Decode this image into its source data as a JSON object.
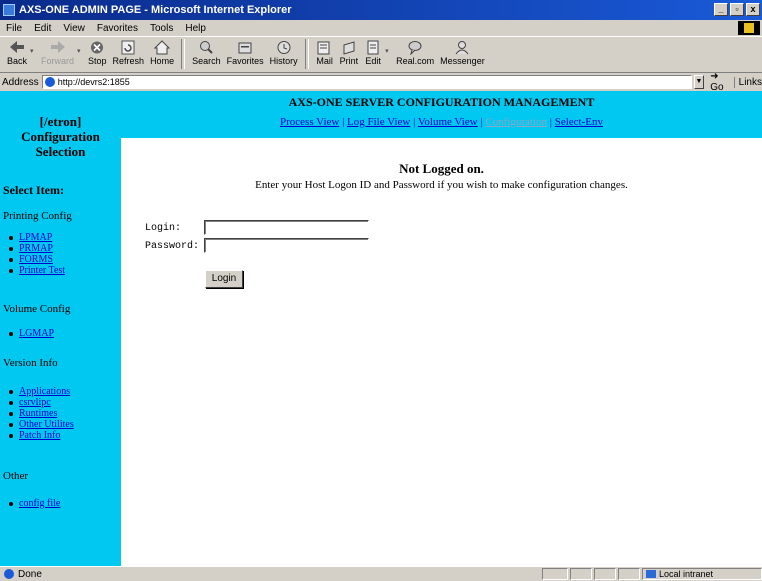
{
  "window": {
    "title": "AXS-ONE ADMIN PAGE - Microsoft Internet Explorer",
    "min": "_",
    "max": "▫",
    "close": "x"
  },
  "menu": [
    "File",
    "Edit",
    "View",
    "Favorites",
    "Tools",
    "Help"
  ],
  "toolbar": [
    {
      "label": "Back",
      "icon": "back-arrow-icon",
      "enabled": true
    },
    {
      "label": "Forward",
      "icon": "forward-arrow-icon",
      "enabled": false
    },
    {
      "label": "Stop",
      "icon": "stop-icon",
      "enabled": true
    },
    {
      "label": "Refresh",
      "icon": "refresh-icon",
      "enabled": true
    },
    {
      "label": "Home",
      "icon": "home-icon",
      "enabled": true
    },
    {
      "label": "Search",
      "icon": "search-icon",
      "enabled": true
    },
    {
      "label": "Favorites",
      "icon": "favorites-icon",
      "enabled": true
    },
    {
      "label": "History",
      "icon": "history-icon",
      "enabled": true
    },
    {
      "label": "Mail",
      "icon": "mail-icon",
      "enabled": true
    },
    {
      "label": "Print",
      "icon": "print-icon",
      "enabled": true
    },
    {
      "label": "Edit",
      "icon": "edit-icon",
      "enabled": true
    },
    {
      "label": "Real.com",
      "icon": "realcom-icon",
      "enabled": true
    },
    {
      "label": "Messenger",
      "icon": "messenger-icon",
      "enabled": true
    }
  ],
  "address": {
    "label": "Address",
    "url": "http://devrs2:1855",
    "go": "Go",
    "links": "Links"
  },
  "sidebar": {
    "header_line1": "[/etron]",
    "header_line2": "Configuration",
    "header_line3": "Selection",
    "select_item": "Select Item:",
    "printing_title": "Printing Config",
    "printing_items": [
      "LPMAP",
      "PRMAP",
      "FORMS",
      "Printer Test"
    ],
    "volume_title": "Volume Config",
    "volume_items": [
      "LGMAP"
    ],
    "version_title": "Version Info",
    "version_items": [
      "Applications",
      "csrvlipc",
      "Runtimes",
      "Other Utilites",
      "Patch Info"
    ],
    "other_title": "Other",
    "other_items": [
      "config file"
    ]
  },
  "top": {
    "title": "AXS-ONE SERVER CONFIGURATION MANAGEMENT",
    "links": [
      {
        "label": "Process View",
        "current": false
      },
      {
        "label": "Log File View",
        "current": false
      },
      {
        "label": "Volume View",
        "current": false
      },
      {
        "label": "Configuration",
        "current": true
      },
      {
        "label": "Select-Env",
        "current": false
      }
    ],
    "separator": "|"
  },
  "main": {
    "heading": "Not Logged on.",
    "message": "Enter your Host Logon ID and Password if you wish to make configuration changes.",
    "login_label": "Login:",
    "password_label": "Password:",
    "login_value": "",
    "password_value": "",
    "login_button": "Login"
  },
  "status": {
    "text": "Done",
    "zone": "Local intranet"
  },
  "colors": {
    "panel": "#00c8f0",
    "link": "#0000cc",
    "titlebar": "#0a2a8a",
    "chrome": "#d4d0c8"
  }
}
